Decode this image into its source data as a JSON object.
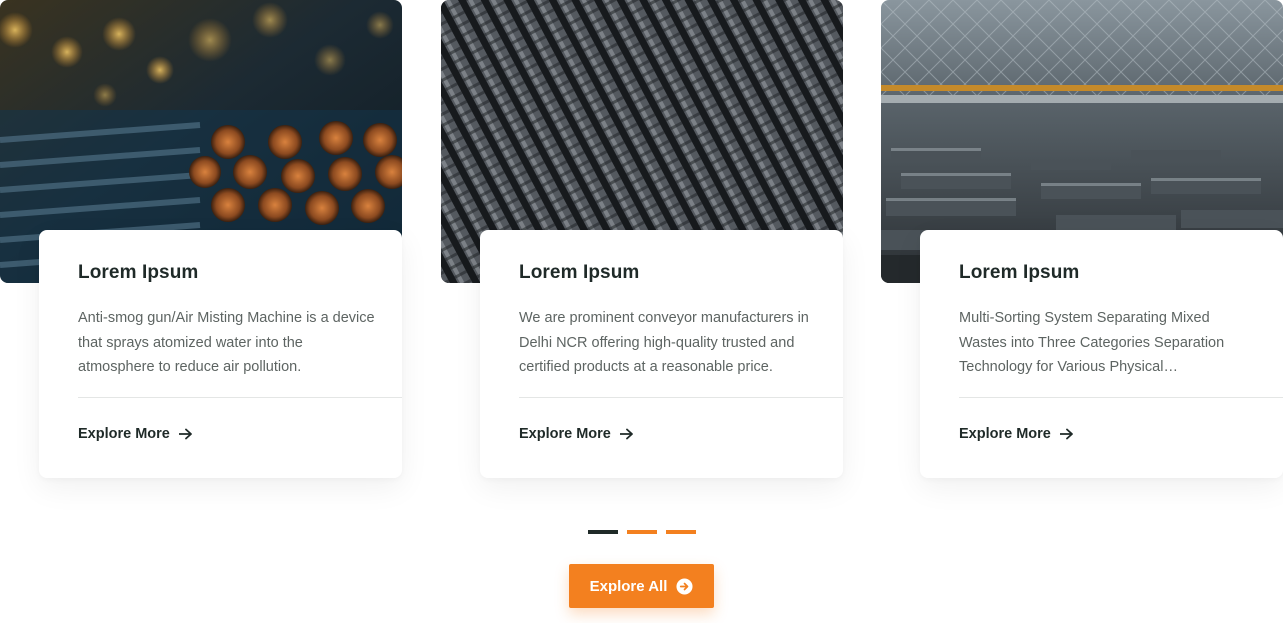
{
  "cards": [
    {
      "title": "Lorem Ipsum",
      "description": "Anti-smog gun/Air Misting Machine is a device that sprays atomized water into the atmosphere to reduce air pollution.",
      "link_label": "Explore More",
      "image_icon": "steel-round-bars-image"
    },
    {
      "title": "Lorem Ipsum",
      "description": "We are prominent conveyor manufacturers in Delhi NCR offering high-quality trusted and certified products at a reasonable price.",
      "link_label": "Explore More",
      "image_icon": "rebar-bundle-image"
    },
    {
      "title": "Lorem Ipsum",
      "description": "Multi-Sorting System Separating Mixed Wastes into Three Categories Separation Technology for Various Physical…",
      "link_label": "Explore More",
      "image_icon": "steel-warehouse-image"
    }
  ],
  "pagination": {
    "pages": 3,
    "active": 1
  },
  "explore_all": {
    "label": "Explore All",
    "icon": "arrow-circle-right-icon"
  },
  "colors": {
    "accent": "#f3801f",
    "dark": "#1f2a28",
    "text_muted": "#5d6462"
  }
}
